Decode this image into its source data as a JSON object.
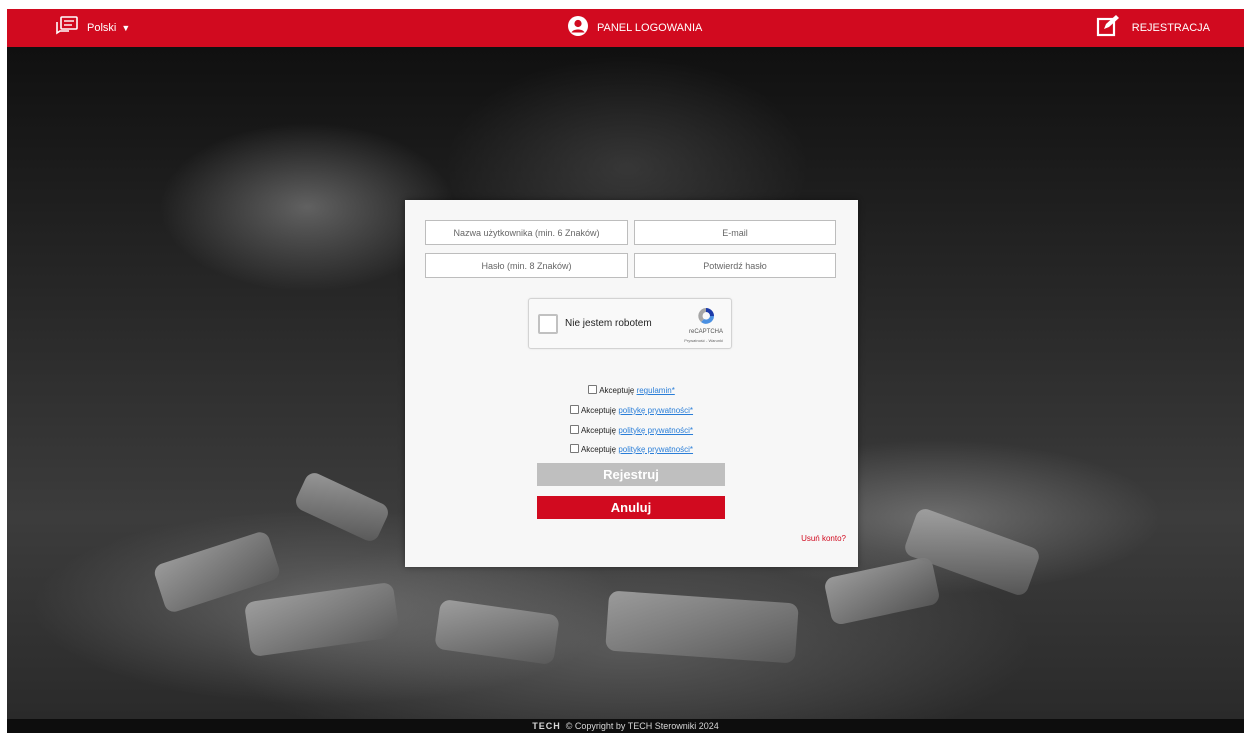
{
  "header": {
    "language_label": "Polski",
    "title": "PANEL LOGOWANIA",
    "register_label": "REJESTRACJA",
    "background_color": "#d10a1f"
  },
  "form": {
    "username_placeholder": "Nazwa użytkownika (min. 6 Znaków)",
    "email_placeholder": "E-mail",
    "password_placeholder": "Hasło (min. 8 Znaków)",
    "confirm_password_placeholder": "Potwierdź hasło",
    "captcha": {
      "label": "Nie jestem robotem",
      "brand": "reCAPTCHA",
      "terms": "Prywatność - Warunki"
    },
    "agreements": [
      {
        "prefix": "Akceptuję",
        "link": "regulamin*"
      },
      {
        "prefix": "Akceptuję",
        "link": "politykę prywatności*"
      },
      {
        "prefix": "Akceptuję",
        "link": "politykę prywatności*"
      },
      {
        "prefix": "Akceptuję",
        "link": "politykę prywatności*"
      }
    ],
    "register_button": "Rejestruj",
    "cancel_button": "Anuluj",
    "delete_account_link": "Usuń konto?"
  },
  "footer": {
    "brand": "TECH",
    "copyright": "© Copyright by TECH Sterowniki 2024"
  },
  "colors": {
    "accent": "#d10a1f",
    "disabled_button": "#bfbfbf",
    "link": "#2a7ed8"
  },
  "icons": {
    "language": "chat-bubbles-icon",
    "panel": "user-circle-icon",
    "register": "edit-icon",
    "language_caret": "caret-down-icon",
    "captcha": "recaptcha-logo-icon"
  }
}
